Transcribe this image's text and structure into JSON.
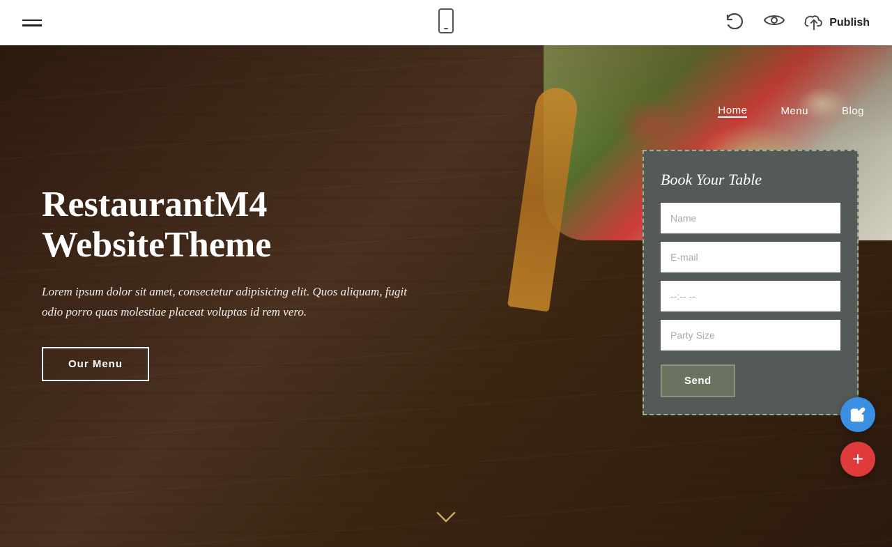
{
  "topbar": {
    "publish_label": "Publish"
  },
  "nav": {
    "items": [
      {
        "label": "Home",
        "active": true
      },
      {
        "label": "Menu",
        "active": false
      },
      {
        "label": "Blog",
        "active": false
      }
    ]
  },
  "hero": {
    "title": "RestaurantM4 WebsiteTheme",
    "description": "Lorem ipsum dolor sit amet, consectetur adipisicing elit. Quos aliquam, fugit odio porro quas molestiae placeat voluptas id rem vero.",
    "button_label": "Our Menu",
    "chevron": "〜"
  },
  "booking": {
    "title": "Book Your Table",
    "fields": [
      {
        "placeholder": "Name",
        "type": "text"
      },
      {
        "placeholder": "E-mail",
        "type": "email"
      },
      {
        "placeholder": "--:-- --",
        "type": "text"
      },
      {
        "placeholder": "Party Size",
        "type": "text"
      }
    ],
    "send_label": "Send"
  }
}
